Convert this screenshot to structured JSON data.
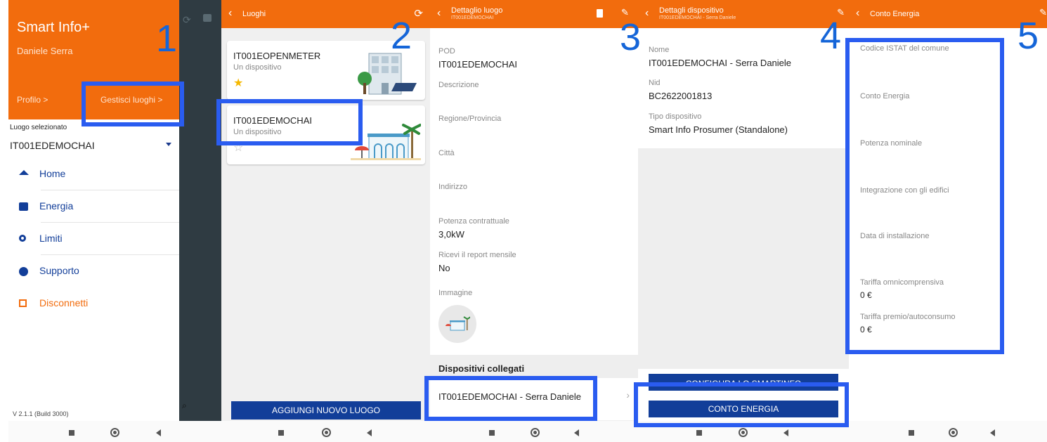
{
  "steps": [
    "1",
    "2",
    "3",
    "4",
    "5"
  ],
  "drawer": {
    "app_title": "Smart Info+",
    "user_name": "Daniele Serra",
    "profile_link": "Profilo >",
    "manage_places_link": "Gestisci luoghi >",
    "selected_place_label": "Luogo selezionato",
    "selected_place": "IT001EDEMOCHAI",
    "menu": [
      {
        "label": "Home",
        "icon": "home-icon"
      },
      {
        "label": "Energia",
        "icon": "energy-icon"
      },
      {
        "label": "Limiti",
        "icon": "search-icon"
      },
      {
        "label": "Supporto",
        "icon": "help-icon"
      },
      {
        "label": "Disconnetti",
        "icon": "logout-icon"
      }
    ],
    "version": "V 2.1.1 (Build 3000)"
  },
  "places": {
    "title": "Luoghi",
    "cards": [
      {
        "name": "IT001EOPENMETER",
        "subtitle": "Un dispositivo",
        "favorite": true
      },
      {
        "name": "IT001EDEMOCHAI",
        "subtitle": "Un dispositivo",
        "favorite": false
      }
    ],
    "add_button": "AGGIUNGI NUOVO LUOGO"
  },
  "place_detail": {
    "title": "Dettaglio luogo",
    "subtitle": "IT001EDEMOCHAI",
    "fields": [
      {
        "label": "POD",
        "value": "IT001EDEMOCHAI"
      },
      {
        "label": "Descrizione",
        "value": ""
      },
      {
        "label": "Regione/Provincia",
        "value": ""
      },
      {
        "label": "Città",
        "value": ""
      },
      {
        "label": "Indirizzo",
        "value": ""
      },
      {
        "label": "Potenza contrattuale",
        "value": "3,0kW"
      },
      {
        "label": "Ricevi il report mensile",
        "value": "No"
      },
      {
        "label": "Immagine",
        "value": ""
      }
    ],
    "connected_header": "Dispositivi collegati",
    "connected_device": "IT001EDEMOCHAI - Serra Daniele"
  },
  "device_detail": {
    "title": "Dettagli dispositivo",
    "subtitle": "IT001EDEMOCHAI - Serra Daniele",
    "fields": [
      {
        "label": "Nome",
        "value": "IT001EDEMOCHAI - Serra Daniele"
      },
      {
        "label": "Nid",
        "value": "BC2622001813"
      },
      {
        "label": "Tipo dispositivo",
        "value": "Smart Info Prosumer (Standalone)"
      }
    ],
    "configure_button": "CONFIGURA LO SMARTINFO",
    "energy_button": "CONTO ENERGIA"
  },
  "energy_account": {
    "title": "Conto Energia",
    "fields": [
      {
        "label": "Codice ISTAT del comune",
        "value": ""
      },
      {
        "label": "Conto Energia",
        "value": ""
      },
      {
        "label": "Potenza nominale",
        "value": ""
      },
      {
        "label": "Integrazione con gli edifici",
        "value": ""
      },
      {
        "label": "Data di installazione",
        "value": ""
      },
      {
        "label": "Tariffa omnicomprensiva",
        "value": "0 €"
      },
      {
        "label": "Tariffa premio/autoconsumo",
        "value": "0 €"
      }
    ]
  },
  "colors": {
    "accent": "#f26c0d",
    "button": "#123e99",
    "highlight": "#2a5cf0",
    "step": "#1565d8"
  }
}
